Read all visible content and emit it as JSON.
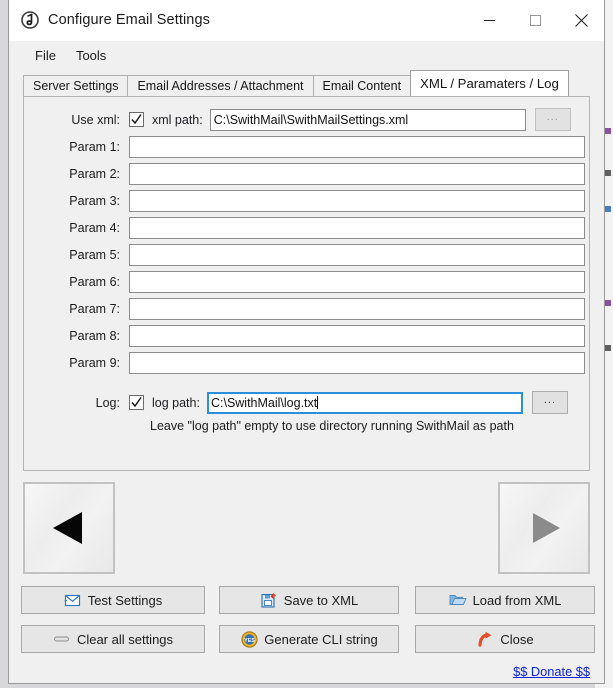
{
  "window": {
    "title": "Configure Email Settings",
    "icon": "app-logo-icon",
    "controls": {
      "minimize": "–",
      "maximize": "□",
      "close": "✕"
    }
  },
  "menubar": {
    "items": [
      {
        "label": "File"
      },
      {
        "label": "Tools"
      }
    ]
  },
  "tabs": [
    {
      "label": "Server Settings",
      "active": false
    },
    {
      "label": "Email Addresses / Attachment",
      "active": false
    },
    {
      "label": "Email Content",
      "active": false
    },
    {
      "label": "XML / Paramaters / Log",
      "active": true
    }
  ],
  "form": {
    "use_xml": {
      "label": "Use xml:",
      "checked": true,
      "path_label": "xml path:",
      "path_value": "C:\\SwithMail\\SwithMailSettings.xml",
      "browse_label": "..."
    },
    "params": [
      {
        "label": "Param 1:",
        "value": ""
      },
      {
        "label": "Param 2:",
        "value": ""
      },
      {
        "label": "Param 3:",
        "value": ""
      },
      {
        "label": "Param 4:",
        "value": ""
      },
      {
        "label": "Param 5:",
        "value": ""
      },
      {
        "label": "Param 6:",
        "value": ""
      },
      {
        "label": "Param 7:",
        "value": ""
      },
      {
        "label": "Param 8:",
        "value": ""
      },
      {
        "label": "Param 9:",
        "value": ""
      }
    ],
    "log": {
      "label": "Log:",
      "checked": true,
      "path_label": "log path:",
      "path_value": "C:\\SwithMail\\log.txt",
      "focused": true,
      "browse_label": "...",
      "hint": "Leave \"log path\" empty to use directory running SwithMail as path"
    }
  },
  "nav": {
    "back_label": "previous-page-arrow",
    "next_label": "next-page-arrow"
  },
  "actions": [
    {
      "label": "Test Settings",
      "icon": "envelope-icon"
    },
    {
      "label": "Save to XML",
      "icon": "save-xml-icon"
    },
    {
      "label": "Load from XML",
      "icon": "folder-open-icon"
    },
    {
      "label": "Clear all settings",
      "icon": "eraser-icon"
    },
    {
      "label": "Generate CLI string",
      "icon": "yes-badge-icon"
    },
    {
      "label": "Close",
      "icon": "exit-arrow-icon"
    }
  ],
  "donate": {
    "label": "$$ Donate $$"
  },
  "colors": {
    "window_bg": "#f0f0f0",
    "titlebar": "#ffffff",
    "accent_focus": "#2a8fdd",
    "link": "#0d23d8",
    "close_hover": "#e81123"
  }
}
